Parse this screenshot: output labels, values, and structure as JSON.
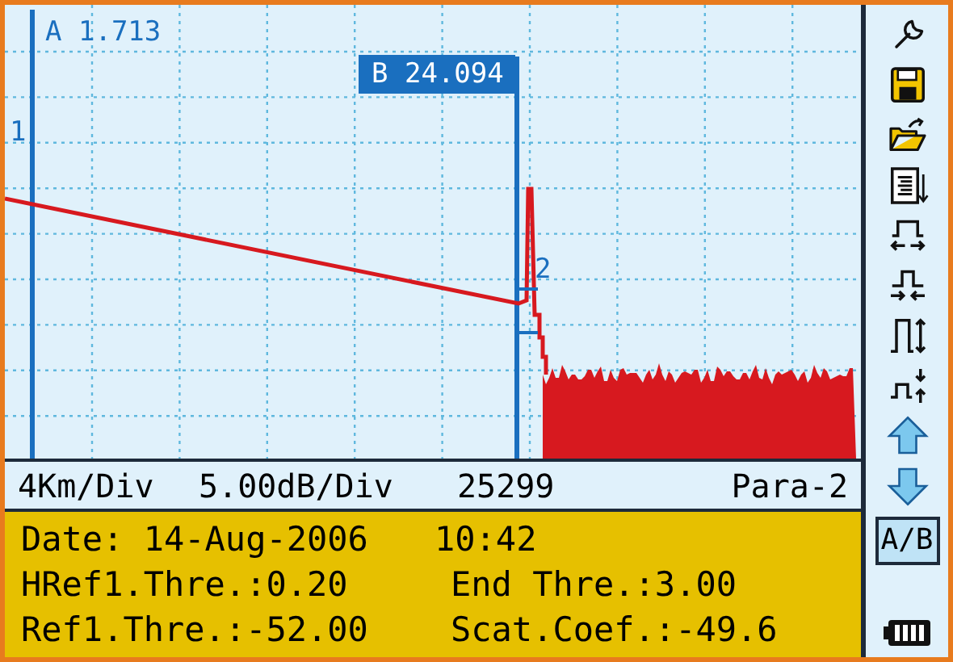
{
  "plot": {
    "cursor_a": {
      "label": "A 1.713"
    },
    "cursor_b": {
      "label": "B 24.094"
    },
    "markers": [
      {
        "label": "1"
      },
      {
        "label": "2"
      }
    ]
  },
  "status_bar": {
    "horizontal_scale": "4Km/Div",
    "vertical_scale": "5.00dB/Div",
    "field_3": "25299",
    "parameter_set": "Para-2"
  },
  "info_panel": {
    "rows": [
      {
        "left": "Date: 14-Aug-2006",
        "right": "10:42"
      },
      {
        "left": "HRef1.Thre.:0.20",
        "right": "End Thre.:3.00"
      },
      {
        "left": "Ref1.Thre.:-52.00",
        "right": "Scat.Coef.:-49.6"
      }
    ]
  },
  "toolbar": [
    {
      "kind": "wrench",
      "selected": false
    },
    {
      "kind": "save",
      "selected": false
    },
    {
      "kind": "open",
      "selected": false
    },
    {
      "kind": "document",
      "selected": false
    },
    {
      "kind": "pulse-expand",
      "selected": false
    },
    {
      "kind": "pulse-compress",
      "selected": false
    },
    {
      "kind": "pulse-taller",
      "selected": false
    },
    {
      "kind": "pulse-shorter",
      "selected": false
    },
    {
      "kind": "arrow-up",
      "selected": false
    },
    {
      "kind": "arrow-down",
      "selected": false
    },
    {
      "kind": "ab",
      "label": "A/B",
      "selected": true
    }
  ]
}
